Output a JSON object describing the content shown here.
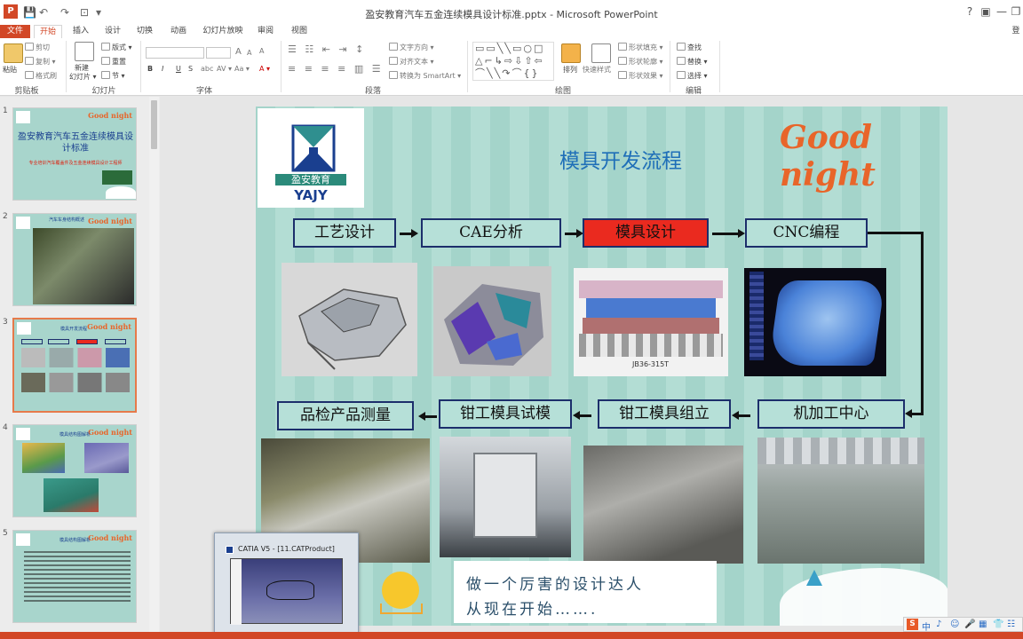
{
  "window": {
    "title": "盈安教育汽车五金连续模具设计标准.pptx - Microsoft PowerPoint",
    "controls": [
      "?",
      "▣",
      "—",
      "❐",
      "✕"
    ],
    "signin": "登"
  },
  "tabs": [
    {
      "label": "文件"
    },
    {
      "label": "开始"
    },
    {
      "label": "插入"
    },
    {
      "label": "设计"
    },
    {
      "label": "切换"
    },
    {
      "label": "动画"
    },
    {
      "label": "幻灯片放映"
    },
    {
      "label": "审阅"
    },
    {
      "label": "视图"
    }
  ],
  "ribbon": {
    "clipboard": {
      "label": "剪贴板",
      "paste": "粘贴",
      "cut": "剪切",
      "copy": "复制 ▾",
      "painter": "格式刷"
    },
    "slides": {
      "label": "幻灯片",
      "new_slide": "新建",
      "new_slide2": "幻灯片 ▾",
      "layout": "版式 ▾",
      "reset": "重置",
      "section": "节 ▾"
    },
    "font": {
      "label": "字体",
      "bold": "B",
      "italic": "I",
      "underline": "U",
      "strike": "S",
      "shadow": "abc",
      "spacing": "AV ▾",
      "case": "Aa ▾",
      "grow": "A",
      "shrink": "A",
      "clear": "A",
      "color": "A ▾"
    },
    "paragraph": {
      "label": "段落",
      "direction": "文字方向 ▾",
      "align_text": "对齐文本 ▾",
      "smartart": "转换为 SmartArt ▾"
    },
    "drawing": {
      "label": "绘图",
      "arrange": "排列",
      "quick_styles": "快速样式",
      "fill": "形状填充 ▾",
      "outline": "形状轮廓 ▾",
      "effects": "形状效果 ▾"
    },
    "editing": {
      "label": "编辑",
      "find": "查找",
      "replace": "替换 ▾",
      "select": "选择 ▾"
    }
  },
  "thumbnails": [
    {
      "num": "1",
      "title": "盈安教育汽车五金连续模具设计标准",
      "subtitle": "专业培训汽车覆盖件及五金连续模具设计工程师",
      "gn": "Good night"
    },
    {
      "num": "2",
      "title": "汽车车身结构概述",
      "gn": "Good night"
    },
    {
      "num": "3",
      "title": "模具开发流程",
      "gn": "Good night",
      "selected": true
    },
    {
      "num": "4",
      "title": "模具结构图解析",
      "gn": "Good night"
    },
    {
      "num": "5",
      "title": "模具结构图解析",
      "gn": "Good night"
    }
  ],
  "slide": {
    "logo_cn": "盈安教育",
    "logo_en": "YAJY",
    "title": "模具开发流程",
    "goodnight": "Good night",
    "steps_top": [
      {
        "label": "工艺设计"
      },
      {
        "label": "CAE分析"
      },
      {
        "label": "模具设计",
        "highlight": true
      },
      {
        "label": "CNC编程"
      }
    ],
    "steps_bottom": [
      {
        "label": "品检产品测量"
      },
      {
        "label": "钳工模具试模"
      },
      {
        "label": "钳工模具组立"
      },
      {
        "label": "机加工中心"
      }
    ],
    "photo_labels": [
      "JB36-315T"
    ],
    "slogan_line1": "做一个厉害的设计达人",
    "slogan_line2": "从现在开始……."
  },
  "popup": {
    "title": "CATIA V5 - [11.CATProduct]"
  },
  "ime": {
    "items": [
      "S",
      "中",
      "♪",
      "☺",
      "🎤",
      "▦",
      "👕",
      "☷"
    ]
  },
  "colors": {
    "accent": "#d24726",
    "slide_bg": "#a8d5cc",
    "step_border": "#1c2e6b",
    "highlight": "#ea2a1f",
    "title_blue": "#1f6fb8",
    "gn_orange": "#e8652a"
  }
}
